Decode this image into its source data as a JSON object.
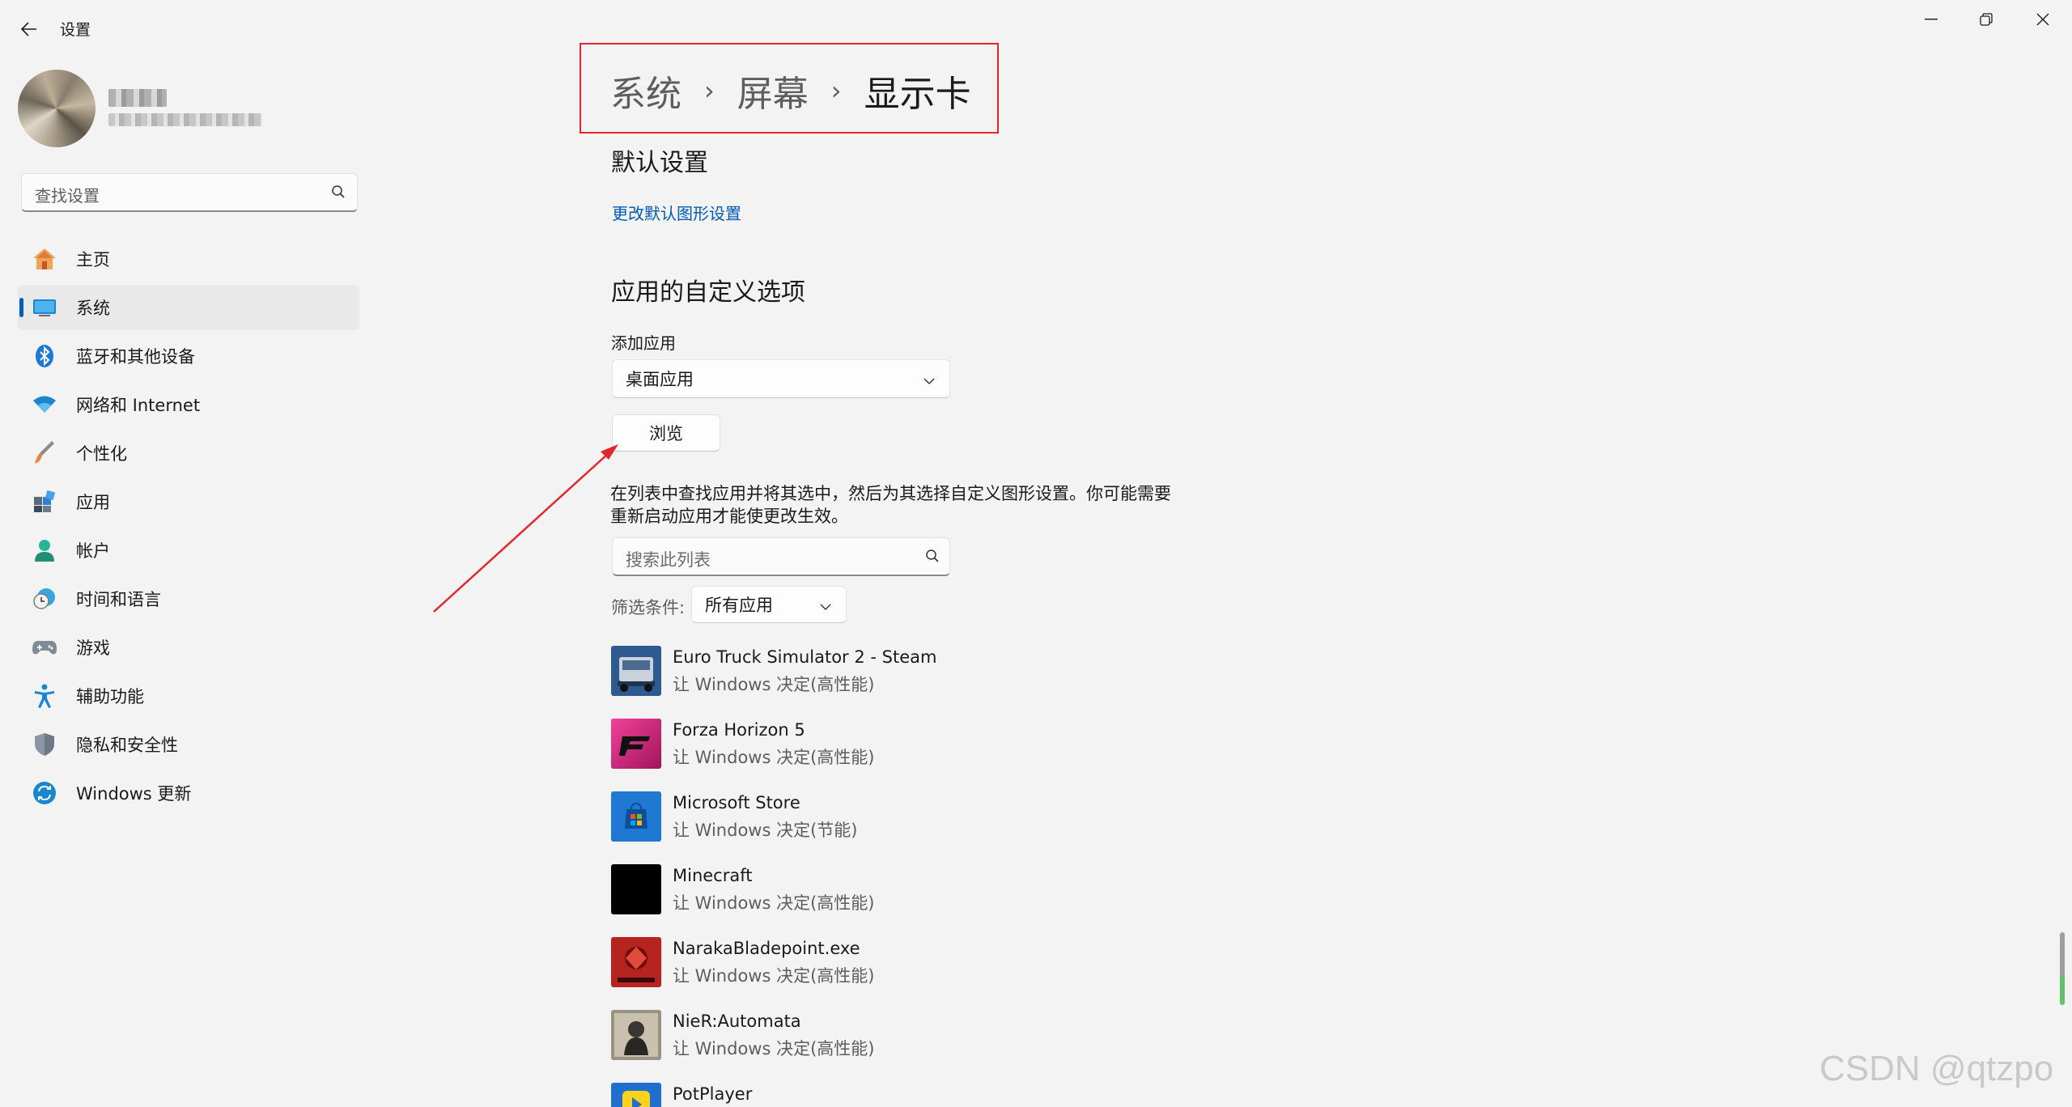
{
  "window": {
    "title": "设置",
    "controls": [
      "minimize-icon",
      "restore-icon",
      "close-icon"
    ]
  },
  "sidebar": {
    "search_placeholder": "查找设置",
    "items": [
      {
        "label": "主页",
        "icon": "home-icon"
      },
      {
        "label": "系统",
        "icon": "monitor-icon",
        "selected": true
      },
      {
        "label": "蓝牙和其他设备",
        "icon": "bluetooth-icon"
      },
      {
        "label": "网络和 Internet",
        "icon": "wifi-icon"
      },
      {
        "label": "个性化",
        "icon": "brush-icon"
      },
      {
        "label": "应用",
        "icon": "apps-icon"
      },
      {
        "label": "帐户",
        "icon": "account-icon"
      },
      {
        "label": "时间和语言",
        "icon": "clock-globe-icon"
      },
      {
        "label": "游戏",
        "icon": "gamepad-icon"
      },
      {
        "label": "辅助功能",
        "icon": "accessibility-icon"
      },
      {
        "label": "隐私和安全性",
        "icon": "shield-icon"
      },
      {
        "label": "Windows 更新",
        "icon": "update-icon"
      }
    ]
  },
  "breadcrumb": {
    "items": [
      "系统",
      "屏幕"
    ],
    "current": "显示卡"
  },
  "main": {
    "default_section_title": "默认设置",
    "default_link": "更改默认图形设置",
    "custom_section_title": "应用的自定义选项",
    "add_app_label": "添加应用",
    "app_type_selected": "桌面应用",
    "browse_label": "浏览",
    "description": "在列表中查找应用并将其选中，然后为其选择自定义图形设置。你可能需要重新启动应用才能使更改生效。",
    "list_search_placeholder": "搜索此列表",
    "filter_label": "筛选条件:",
    "filter_selected": "所有应用"
  },
  "apps": [
    {
      "name": "Euro Truck Simulator 2 - Steam",
      "preference": "让 Windows 决定(高性能)",
      "icon": "truck-icon"
    },
    {
      "name": "Forza Horizon 5",
      "preference": "让 Windows 决定(高性能)",
      "icon": "forza-icon"
    },
    {
      "name": "Microsoft Store",
      "preference": "让 Windows 决定(节能)",
      "icon": "store-icon"
    },
    {
      "name": "Minecraft",
      "preference": "让 Windows 决定(高性能)",
      "icon": "minecraft-icon"
    },
    {
      "name": "NarakaBladepoint.exe",
      "preference": "让 Windows 决定(高性能)",
      "icon": "naraka-icon"
    },
    {
      "name": "NieR:Automata",
      "preference": "让 Windows 决定(高性能)",
      "icon": "nier-icon"
    },
    {
      "name": "PotPlayer",
      "preference": "",
      "icon": "potplayer-icon"
    }
  ],
  "watermark": "CSDN @qtzpo",
  "colors": {
    "accent": "#005fb8",
    "link": "#0059b8",
    "annotation": "#e3262e",
    "background": "#f3f3f3"
  }
}
